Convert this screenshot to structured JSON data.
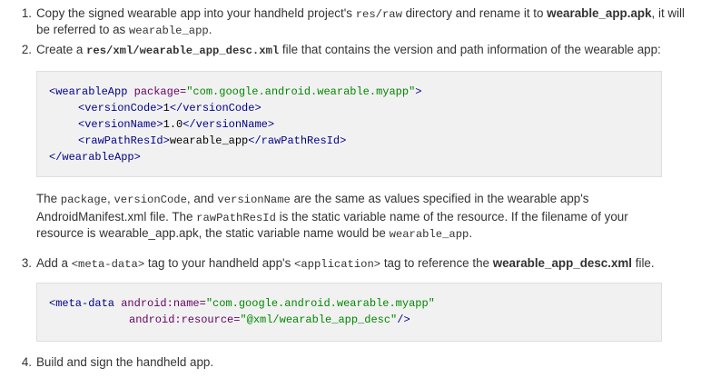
{
  "step1": {
    "num": "1.",
    "l1a": "Copy the signed wearable app into your handheld project's ",
    "l1b": "res/raw",
    "l1c": " directory and rename it to ",
    "l1d": "wearable_app.apk",
    "l1e": ", it will",
    "l2a": "be referred to as ",
    "l2b": "wearable_app",
    "l2c": "."
  },
  "step2": {
    "num": "2.",
    "a": "Create a ",
    "b": "res/xml/wearable_app_desc.xml",
    "c": " file that contains the version and path information of the wearable app:"
  },
  "code1": {
    "l1_open": "<wearableApp",
    "l1_attr": " package=",
    "l1_val": "\"com.google.android.wearable.myapp\"",
    "l1_close": ">",
    "l2_open": "<versionCode>",
    "l2_val": "1",
    "l2_close": "</versionCode>",
    "l3_open": "<versionName>",
    "l3_val": "1.0",
    "l3_close": "</versionName>",
    "l4_open": "<rawPathResId>",
    "l4_val": "wearable_app",
    "l4_close": "</rawPathResId>",
    "l5": "</wearableApp>"
  },
  "para": {
    "l1a": "The ",
    "l1b": "package",
    "l1c": ", ",
    "l1d": "versionCode",
    "l1e": ", and ",
    "l1f": "versionName",
    "l1g": " are the same as values specified in the wearable app's",
    "l2a": "AndroidManifest.xml file. The ",
    "l2b": "rawPathResId",
    "l2c": " is the static variable name of the resource. If the filename of your",
    "l3a": "resource is wearable_app.apk, the static variable name would be ",
    "l3b": "wearable_app",
    "l3c": "."
  },
  "step3": {
    "num": "3.",
    "a": "Add a ",
    "b": "<meta-data>",
    "c": " tag to your handheld app's ",
    "d": "<application>",
    "e": " tag to reference the ",
    "f": "wearable_app_desc.xml",
    "g": " file."
  },
  "code2": {
    "l1_open": "<meta-data",
    "l1_attr": " android:name=",
    "l1_val": "\"com.google.android.wearable.myapp\"",
    "l2_attr": "android:resource=",
    "l2_val": "\"@xml/wearable_app_desc\"",
    "l2_close": "/>"
  },
  "step4": {
    "num": "4.",
    "text": "Build and sign the handheld app."
  }
}
